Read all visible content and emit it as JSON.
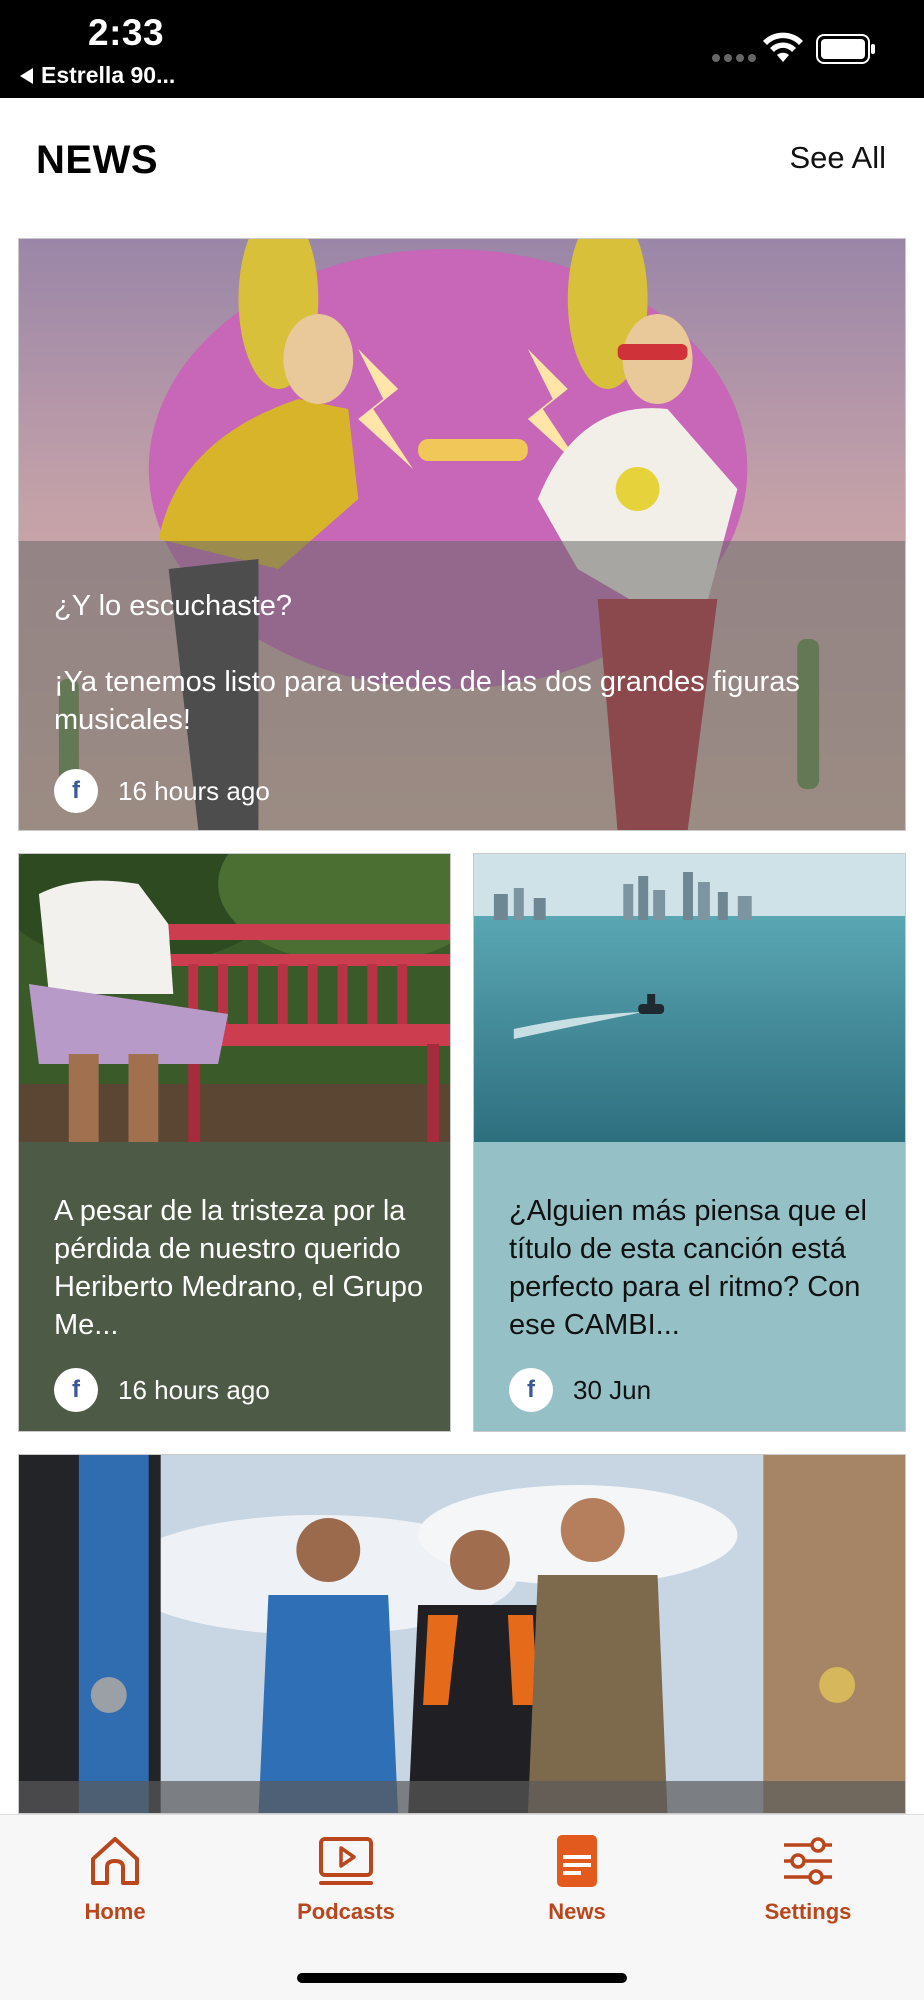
{
  "status_bar": {
    "time": "2:33",
    "back_app": "Estrella 90..."
  },
  "header": {
    "title": "NEWS",
    "see_all_label": "See All"
  },
  "cards": [
    {
      "text": "¿Y lo escuchaste?\n\n¡Ya tenemos listo para ustedes de las dos grandes figuras musicales!",
      "source_icon": "facebook-icon",
      "time": "16 hours ago"
    },
    {
      "text": "A pesar de la tristeza por la pérdida de nuestro querido Heriberto Medrano, el Grupo Me...",
      "source_icon": "facebook-icon",
      "time": "16 hours ago"
    },
    {
      "text": "¿Alguien más piensa que el título de esta canción está perfecto para el ritmo? Con ese CAMBI...",
      "source_icon": "facebook-icon",
      "time": "30 Jun"
    }
  ],
  "tabs": [
    {
      "label": "Home",
      "icon": "home-icon"
    },
    {
      "label": "Podcasts",
      "icon": "podcast-play-icon"
    },
    {
      "label": "News",
      "icon": "news-icon",
      "active": true
    },
    {
      "label": "Settings",
      "icon": "sliders-icon"
    }
  ],
  "colors": {
    "accent": "#b9461c",
    "card_2_background": "#4d5a45",
    "card_3_background": "#94c0c6"
  }
}
